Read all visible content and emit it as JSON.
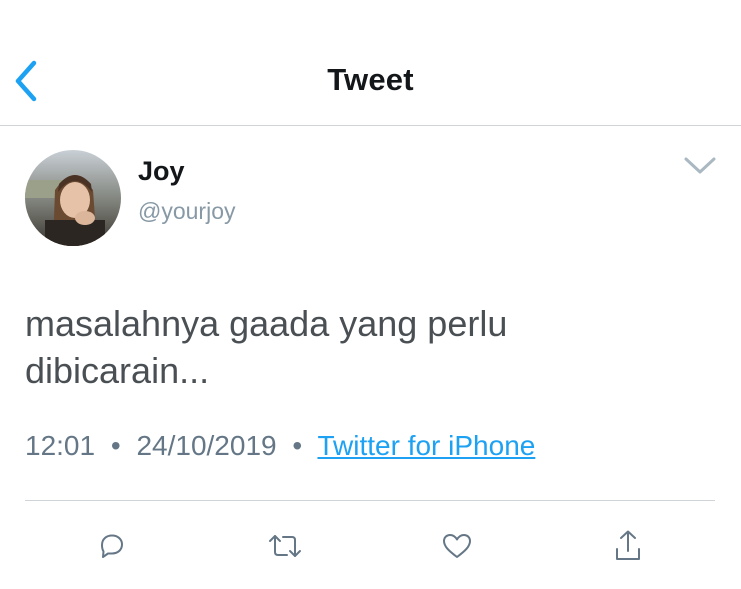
{
  "header": {
    "title": "Tweet",
    "back_icon": "chevron-left-icon"
  },
  "author": {
    "name": "Joy",
    "handle": "@yourjoy"
  },
  "tweet": {
    "text_line1": "masalahnya gaada yang perlu",
    "text_line2": "dibicarain...",
    "time": "12:01",
    "date": "24/10/2019",
    "separator": "•",
    "source": "Twitter for iPhone"
  },
  "actions": {
    "reply_icon": "reply-icon",
    "retweet_icon": "retweet-icon",
    "like_icon": "heart-icon",
    "share_icon": "share-icon"
  },
  "colors": {
    "accent": "#1da1f2",
    "text_primary": "#14171a",
    "text_secondary": "#657786",
    "icon": "#657786"
  }
}
